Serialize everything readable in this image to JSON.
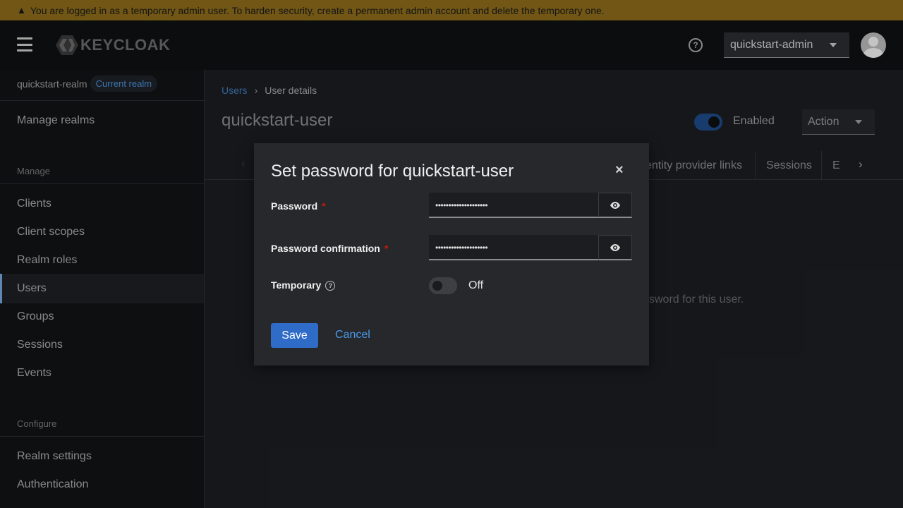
{
  "banner": {
    "icon": "warning-icon",
    "text": "You are logged in as a temporary admin user. To harden security, create a permanent admin account and delete the temporary one."
  },
  "header": {
    "logo_text": "KEYCLOAK",
    "user_menu": "quickstart-admin"
  },
  "sidebar": {
    "realm_name": "quickstart-realm",
    "realm_badge": "Current realm",
    "manage_realms": "Manage realms",
    "section_manage": "Manage",
    "items_manage": [
      "Clients",
      "Client scopes",
      "Realm roles",
      "Users",
      "Groups",
      "Sessions",
      "Events"
    ],
    "section_configure": "Configure",
    "items_configure": [
      "Realm settings",
      "Authentication"
    ],
    "active_item": "Users"
  },
  "main": {
    "breadcrumb_link": "Users",
    "breadcrumb_current": "User details",
    "title": "quickstart-user",
    "enabled_label": "Enabled",
    "action_label": "Action",
    "tabs": [
      "entity provider links",
      "Sessions",
      "E"
    ],
    "empty_text": "sword for this user."
  },
  "modal": {
    "title": "Set password for quickstart-user",
    "password_label": "Password",
    "password_value": "••••••••••••••••••••",
    "confirm_label": "Password confirmation",
    "confirm_value": "••••••••••••••••••••",
    "temporary_label": "Temporary",
    "temporary_state": "Off",
    "save_label": "Save",
    "cancel_label": "Cancel"
  },
  "colors": {
    "banner": "#8a6a1a",
    "primary": "#2f6cc7",
    "link": "#4a9ae8",
    "required": "#c9190b"
  }
}
